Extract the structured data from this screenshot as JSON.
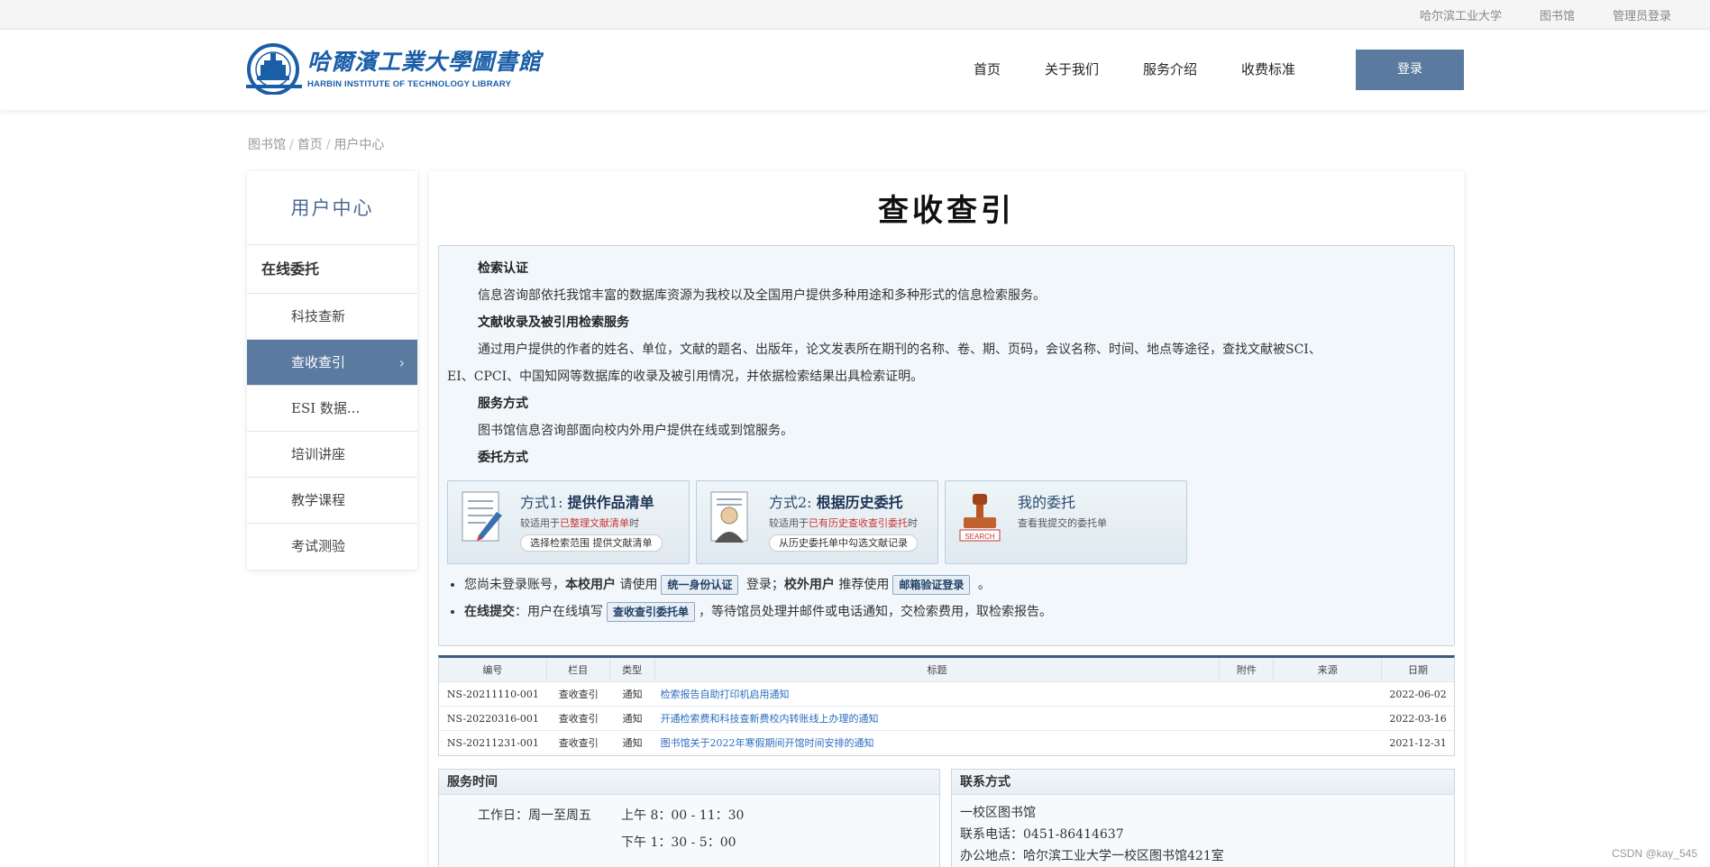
{
  "topbar": {
    "links": [
      "哈尔滨工业大学",
      "图书馆",
      "管理员登录"
    ]
  },
  "logo": {
    "cn": "哈爾濱工業大學圖書館",
    "en": "HARBIN INSTITUTE OF TECHNOLOGY LIBRARY"
  },
  "nav": {
    "items": [
      "首页",
      "关于我们",
      "服务介绍",
      "收费标准"
    ],
    "login": "登录"
  },
  "breadcrumb": [
    "图书馆",
    "首页",
    "用户中心"
  ],
  "sidebar": {
    "title": "用户中心",
    "group": "在线委托",
    "items": [
      "科技查新",
      "查收查引",
      "ESI 数据...",
      "培训讲座",
      "教学课程",
      "考试测验"
    ],
    "active_index": 1
  },
  "main": {
    "title": "查收查引",
    "sections": {
      "s1_title": "检索认证",
      "s1_text": "信息咨询部依托我馆丰富的数据库资源为我校以及全国用户提供多种用途和多种形式的信息检索服务。",
      "s2_title": "文献收录及被引用检索服务",
      "s2_text_a": "通过用户提供的作者的姓名、单位，文献的题名、出版年，论文发表所在期刊的名称、卷、期、页码，会议名称、时间、地点等途径，查找文献被SCI、",
      "s2_text_b": "EI、CPCI、中国知网等数据库的收录及被引用情况，并依据检索结果出具检索证明。",
      "s3_title": "服务方式",
      "s3_text": "图书馆信息咨询部面向校内外用户提供在线或到馆服务。",
      "s4_title": "委托方式"
    },
    "cards": [
      {
        "prefix": "方式1:",
        "title": "提供作品清单",
        "sub_a": "较适用于",
        "sub_hl": "已整理文献清单",
        "sub_b": "时",
        "button": "选择检索范围 提供文献清单"
      },
      {
        "prefix": "方式2:",
        "title": "根据历史委托",
        "sub_a": "较适用于",
        "sub_hl": "已有历史查收查引委托",
        "sub_b": "时",
        "button": "从历史委托单中勾选文献记录"
      },
      {
        "title": "我的委托",
        "sub": "查看我提交的委托单"
      }
    ],
    "bullet1": {
      "a": "您尚未登录账号，",
      "b": "本校用户",
      "c": " 请使用",
      "tag1": "统一身份认证",
      "d": " 登录；",
      "e": "校外用户",
      "f": " 推荐使用",
      "tag2": "邮箱验证登录",
      "g": " 。"
    },
    "bullet2": {
      "a": "在线提交",
      "b": "：用户在线填写",
      "tag": "查收查引委托单",
      "c": "，等待馆员处理并邮件或电话通知，交检索费用，取检索报告。"
    }
  },
  "table": {
    "headers": [
      "编号",
      "栏目",
      "类型",
      "标题",
      "附件",
      "来源",
      "日期"
    ],
    "rows": [
      [
        "NS-20211110-001",
        "查收查引",
        "通知",
        "检索报告自助打印机启用通知",
        "",
        "",
        "2022-06-02"
      ],
      [
        "NS-20220316-001",
        "查收查引",
        "通知",
        "开通检索费和科技查新费校内转账线上办理的通知",
        "",
        "",
        "2022-03-16"
      ],
      [
        "NS-20211231-001",
        "查收查引",
        "通知",
        "图书馆关于2022年寒假期间开馆时间安排的通知",
        "",
        "",
        "2021-12-31"
      ]
    ]
  },
  "service_time": {
    "title": "服务时间",
    "label": "工作日：周一至周五",
    "am": "上午 8：00 - 11：30",
    "pm": "下午 1：30 - 5：00"
  },
  "contact": {
    "title": "联系方式",
    "line1": "一校区图书馆",
    "line2": "联系电话：0451-86414637",
    "line3": "办公地点：哈尔滨工业大学一校区图书馆421室"
  },
  "watermark": "CSDN @kay_545",
  "colors": {
    "primary": "#5a7aa0",
    "link": "#2a6dbf",
    "highlight": "#cc3333"
  }
}
